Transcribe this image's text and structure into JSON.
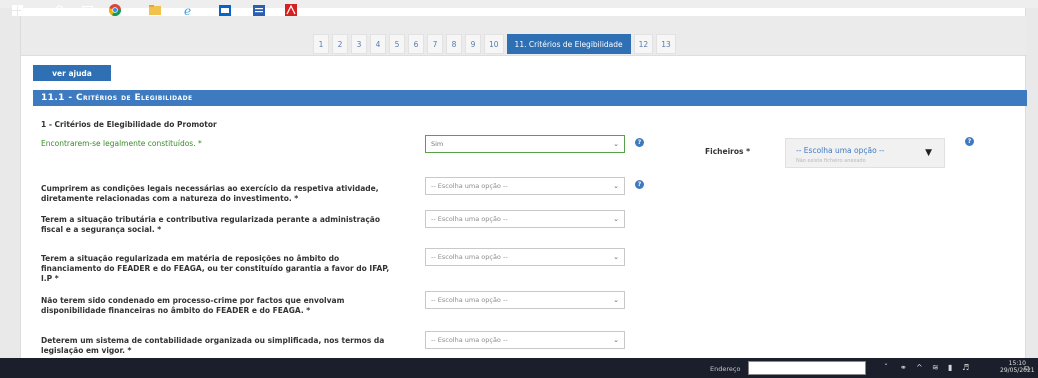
{
  "pagination": {
    "pages": [
      "1",
      "2",
      "3",
      "4",
      "5",
      "6",
      "7",
      "8",
      "9",
      "10",
      "11. Critérios de Elegibilidade",
      "12",
      "13"
    ],
    "active_index": 10
  },
  "help_button": "ver ajuda",
  "section_title": "11.1 - Critérios de Elegibilidade",
  "subsection_title": "1 - Critérios de Elegibilidade do Promotor",
  "questions": [
    {
      "label": "Encontrarem-se legalmente constituídos. *",
      "value": "Sim"
    },
    {
      "label": "Cumprirem as condições legais necessárias ao exercício da respetiva atividade, diretamente relacionadas com a natureza do investimento. *",
      "value": "-- Escolha uma opção --"
    },
    {
      "label": "Terem a situação tributária e contributiva regularizada perante a administração fiscal e a segurança social. *",
      "value": "-- Escolha uma opção --"
    },
    {
      "label": "Terem a situação regularizada em matéria de reposições no âmbito do financiamento do FEADER e do FEAGA, ou ter constituído garantia a favor do IFAP, I.P *",
      "value": "-- Escolha uma opção --"
    },
    {
      "label": "Não terem sido condenado em processo-crime por factos que envolvam disponibilidade financeiras no âmbito do FEADER e do FEAGA. *",
      "value": "-- Escolha uma opção --"
    },
    {
      "label": "Deterem um sistema de contabilidade organizada ou simplificada, nos termos da legislação em vigor. *",
      "value": "-- Escolha uma opção --"
    }
  ],
  "files": {
    "label": "Ficheiros *",
    "placeholder": "-- Escolha uma opção --",
    "empty_text": "Não existe ficheiro anexado"
  },
  "taskbar": {
    "address_label": "Endereço",
    "time": "15:10",
    "date": "29/05/2021"
  },
  "colors": {
    "accent": "#3d7ac0",
    "active_page": "#2f6fb3",
    "valid_green": "#3a8a2a",
    "taskbar": "#1b1f2b"
  }
}
